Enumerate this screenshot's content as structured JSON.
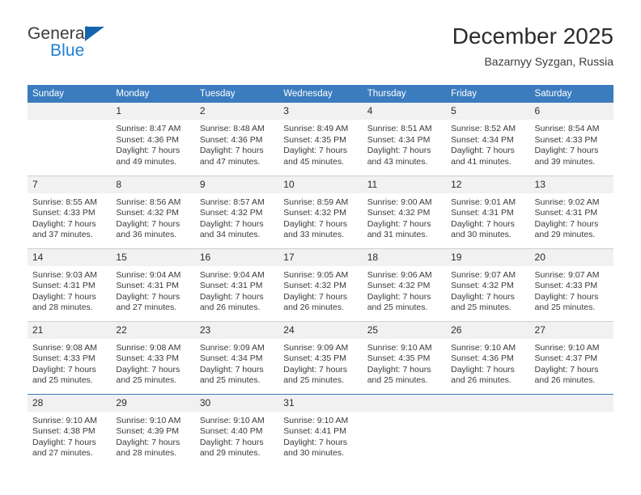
{
  "brand": {
    "name_part1": "General",
    "name_part2": "Blue",
    "triangle_color": "#1565ad",
    "blue_text_color": "#1f7fd4"
  },
  "header": {
    "title": "December 2025",
    "subtitle": "Bazarnyy Syzgan, Russia"
  },
  "theme": {
    "header_row_background": "#3b7cbf",
    "daynum_background": "#f1f1f1",
    "grid_line": "#cfcfcf",
    "accent_line": "#3b7cbf"
  },
  "weekdays": [
    "Sunday",
    "Monday",
    "Tuesday",
    "Wednesday",
    "Thursday",
    "Friday",
    "Saturday"
  ],
  "weeks": [
    [
      {
        "day": "",
        "sunrise": "",
        "sunset": "",
        "daylight_line1": "",
        "daylight_line2": ""
      },
      {
        "day": "1",
        "sunrise": "Sunrise: 8:47 AM",
        "sunset": "Sunset: 4:36 PM",
        "daylight_line1": "Daylight: 7 hours",
        "daylight_line2": "and 49 minutes."
      },
      {
        "day": "2",
        "sunrise": "Sunrise: 8:48 AM",
        "sunset": "Sunset: 4:36 PM",
        "daylight_line1": "Daylight: 7 hours",
        "daylight_line2": "and 47 minutes."
      },
      {
        "day": "3",
        "sunrise": "Sunrise: 8:49 AM",
        "sunset": "Sunset: 4:35 PM",
        "daylight_line1": "Daylight: 7 hours",
        "daylight_line2": "and 45 minutes."
      },
      {
        "day": "4",
        "sunrise": "Sunrise: 8:51 AM",
        "sunset": "Sunset: 4:34 PM",
        "daylight_line1": "Daylight: 7 hours",
        "daylight_line2": "and 43 minutes."
      },
      {
        "day": "5",
        "sunrise": "Sunrise: 8:52 AM",
        "sunset": "Sunset: 4:34 PM",
        "daylight_line1": "Daylight: 7 hours",
        "daylight_line2": "and 41 minutes."
      },
      {
        "day": "6",
        "sunrise": "Sunrise: 8:54 AM",
        "sunset": "Sunset: 4:33 PM",
        "daylight_line1": "Daylight: 7 hours",
        "daylight_line2": "and 39 minutes."
      }
    ],
    [
      {
        "day": "7",
        "sunrise": "Sunrise: 8:55 AM",
        "sunset": "Sunset: 4:33 PM",
        "daylight_line1": "Daylight: 7 hours",
        "daylight_line2": "and 37 minutes."
      },
      {
        "day": "8",
        "sunrise": "Sunrise: 8:56 AM",
        "sunset": "Sunset: 4:32 PM",
        "daylight_line1": "Daylight: 7 hours",
        "daylight_line2": "and 36 minutes."
      },
      {
        "day": "9",
        "sunrise": "Sunrise: 8:57 AM",
        "sunset": "Sunset: 4:32 PM",
        "daylight_line1": "Daylight: 7 hours",
        "daylight_line2": "and 34 minutes."
      },
      {
        "day": "10",
        "sunrise": "Sunrise: 8:59 AM",
        "sunset": "Sunset: 4:32 PM",
        "daylight_line1": "Daylight: 7 hours",
        "daylight_line2": "and 33 minutes."
      },
      {
        "day": "11",
        "sunrise": "Sunrise: 9:00 AM",
        "sunset": "Sunset: 4:32 PM",
        "daylight_line1": "Daylight: 7 hours",
        "daylight_line2": "and 31 minutes."
      },
      {
        "day": "12",
        "sunrise": "Sunrise: 9:01 AM",
        "sunset": "Sunset: 4:31 PM",
        "daylight_line1": "Daylight: 7 hours",
        "daylight_line2": "and 30 minutes."
      },
      {
        "day": "13",
        "sunrise": "Sunrise: 9:02 AM",
        "sunset": "Sunset: 4:31 PM",
        "daylight_line1": "Daylight: 7 hours",
        "daylight_line2": "and 29 minutes."
      }
    ],
    [
      {
        "day": "14",
        "sunrise": "Sunrise: 9:03 AM",
        "sunset": "Sunset: 4:31 PM",
        "daylight_line1": "Daylight: 7 hours",
        "daylight_line2": "and 28 minutes."
      },
      {
        "day": "15",
        "sunrise": "Sunrise: 9:04 AM",
        "sunset": "Sunset: 4:31 PM",
        "daylight_line1": "Daylight: 7 hours",
        "daylight_line2": "and 27 minutes."
      },
      {
        "day": "16",
        "sunrise": "Sunrise: 9:04 AM",
        "sunset": "Sunset: 4:31 PM",
        "daylight_line1": "Daylight: 7 hours",
        "daylight_line2": "and 26 minutes."
      },
      {
        "day": "17",
        "sunrise": "Sunrise: 9:05 AM",
        "sunset": "Sunset: 4:32 PM",
        "daylight_line1": "Daylight: 7 hours",
        "daylight_line2": "and 26 minutes."
      },
      {
        "day": "18",
        "sunrise": "Sunrise: 9:06 AM",
        "sunset": "Sunset: 4:32 PM",
        "daylight_line1": "Daylight: 7 hours",
        "daylight_line2": "and 25 minutes."
      },
      {
        "day": "19",
        "sunrise": "Sunrise: 9:07 AM",
        "sunset": "Sunset: 4:32 PM",
        "daylight_line1": "Daylight: 7 hours",
        "daylight_line2": "and 25 minutes."
      },
      {
        "day": "20",
        "sunrise": "Sunrise: 9:07 AM",
        "sunset": "Sunset: 4:33 PM",
        "daylight_line1": "Daylight: 7 hours",
        "daylight_line2": "and 25 minutes."
      }
    ],
    [
      {
        "day": "21",
        "sunrise": "Sunrise: 9:08 AM",
        "sunset": "Sunset: 4:33 PM",
        "daylight_line1": "Daylight: 7 hours",
        "daylight_line2": "and 25 minutes."
      },
      {
        "day": "22",
        "sunrise": "Sunrise: 9:08 AM",
        "sunset": "Sunset: 4:33 PM",
        "daylight_line1": "Daylight: 7 hours",
        "daylight_line2": "and 25 minutes."
      },
      {
        "day": "23",
        "sunrise": "Sunrise: 9:09 AM",
        "sunset": "Sunset: 4:34 PM",
        "daylight_line1": "Daylight: 7 hours",
        "daylight_line2": "and 25 minutes."
      },
      {
        "day": "24",
        "sunrise": "Sunrise: 9:09 AM",
        "sunset": "Sunset: 4:35 PM",
        "daylight_line1": "Daylight: 7 hours",
        "daylight_line2": "and 25 minutes."
      },
      {
        "day": "25",
        "sunrise": "Sunrise: 9:10 AM",
        "sunset": "Sunset: 4:35 PM",
        "daylight_line1": "Daylight: 7 hours",
        "daylight_line2": "and 25 minutes."
      },
      {
        "day": "26",
        "sunrise": "Sunrise: 9:10 AM",
        "sunset": "Sunset: 4:36 PM",
        "daylight_line1": "Daylight: 7 hours",
        "daylight_line2": "and 26 minutes."
      },
      {
        "day": "27",
        "sunrise": "Sunrise: 9:10 AM",
        "sunset": "Sunset: 4:37 PM",
        "daylight_line1": "Daylight: 7 hours",
        "daylight_line2": "and 26 minutes."
      }
    ],
    [
      {
        "day": "28",
        "sunrise": "Sunrise: 9:10 AM",
        "sunset": "Sunset: 4:38 PM",
        "daylight_line1": "Daylight: 7 hours",
        "daylight_line2": "and 27 minutes."
      },
      {
        "day": "29",
        "sunrise": "Sunrise: 9:10 AM",
        "sunset": "Sunset: 4:39 PM",
        "daylight_line1": "Daylight: 7 hours",
        "daylight_line2": "and 28 minutes."
      },
      {
        "day": "30",
        "sunrise": "Sunrise: 9:10 AM",
        "sunset": "Sunset: 4:40 PM",
        "daylight_line1": "Daylight: 7 hours",
        "daylight_line2": "and 29 minutes."
      },
      {
        "day": "31",
        "sunrise": "Sunrise: 9:10 AM",
        "sunset": "Sunset: 4:41 PM",
        "daylight_line1": "Daylight: 7 hours",
        "daylight_line2": "and 30 minutes."
      },
      {
        "day": "",
        "sunrise": "",
        "sunset": "",
        "daylight_line1": "",
        "daylight_line2": ""
      },
      {
        "day": "",
        "sunrise": "",
        "sunset": "",
        "daylight_line1": "",
        "daylight_line2": ""
      },
      {
        "day": "",
        "sunrise": "",
        "sunset": "",
        "daylight_line1": "",
        "daylight_line2": ""
      }
    ]
  ]
}
